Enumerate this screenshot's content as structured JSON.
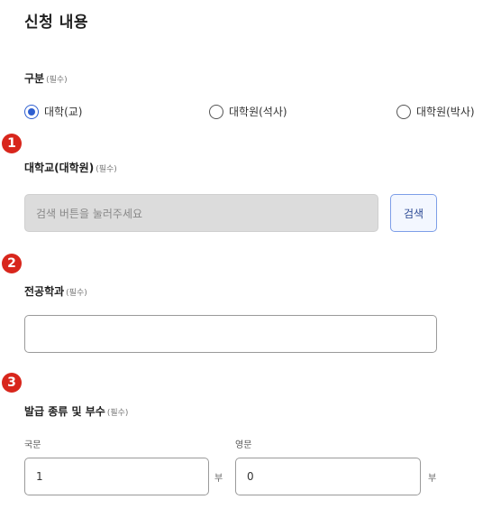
{
  "section_title": "신청 내용",
  "required_tag": "(필수)",
  "category": {
    "label": "구분",
    "options": [
      {
        "label": "대학(교)",
        "selected": true
      },
      {
        "label": "대학원(석사)",
        "selected": false
      },
      {
        "label": "대학원(박사)",
        "selected": false
      }
    ]
  },
  "badges": [
    "1",
    "2",
    "3"
  ],
  "university": {
    "label": "대학교(대학원)",
    "placeholder": "검색 버튼을 눌러주세요",
    "search_button": "검색"
  },
  "major": {
    "label": "전공학과",
    "value": ""
  },
  "issue": {
    "label": "발급 종류 및 부수",
    "korean_label": "국문",
    "korean_value": "1",
    "english_label": "영문",
    "english_value": "0",
    "unit": "부"
  },
  "colors": {
    "accent": "#2e5fd0",
    "badge": "#d8261c",
    "disabled_bg": "#dcdcdc"
  }
}
